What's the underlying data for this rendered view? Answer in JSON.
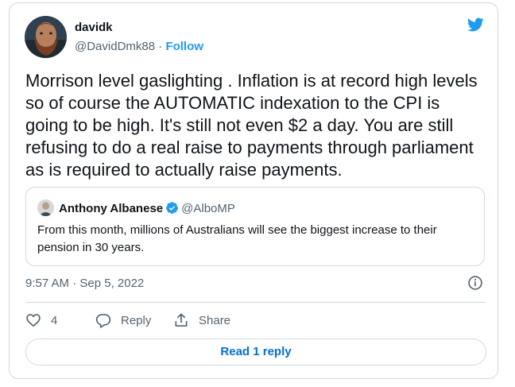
{
  "author": {
    "name": "davidk",
    "handle": "@DavidDmk88",
    "separator": "·",
    "follow_label": "Follow"
  },
  "tweet": {
    "text": "Morrison level gaslighting . Inflation is at record high levels so of course the AUTOMATIC indexation to the CPI is going to be high. It's still not even $2 a day. You are still refusing to do a real raise to payments through parliament as is required to actually raise payments.",
    "timestamp": "9:57 AM · Sep 5, 2022"
  },
  "quoted_tweet": {
    "name": "Anthony Albanese",
    "handle": "@AlboMP",
    "text": "From this month, millions of Australians will see the biggest increase to their pension in 30 years."
  },
  "actions": {
    "like_count": "4",
    "reply_label": "Reply",
    "share_label": "Share"
  },
  "read_replies_label": "Read 1 reply",
  "icons": {
    "brand": "twitter-bird-icon",
    "verified": "verified-badge-icon",
    "info": "info-icon",
    "like": "heart-icon",
    "reply": "reply-bubble-icon",
    "share": "share-icon"
  },
  "colors": {
    "accent": "#1d9bf0",
    "link_button": "#006fd6",
    "secondary_text": "#536471",
    "border": "#cfd9de",
    "text": "#0f1419"
  }
}
